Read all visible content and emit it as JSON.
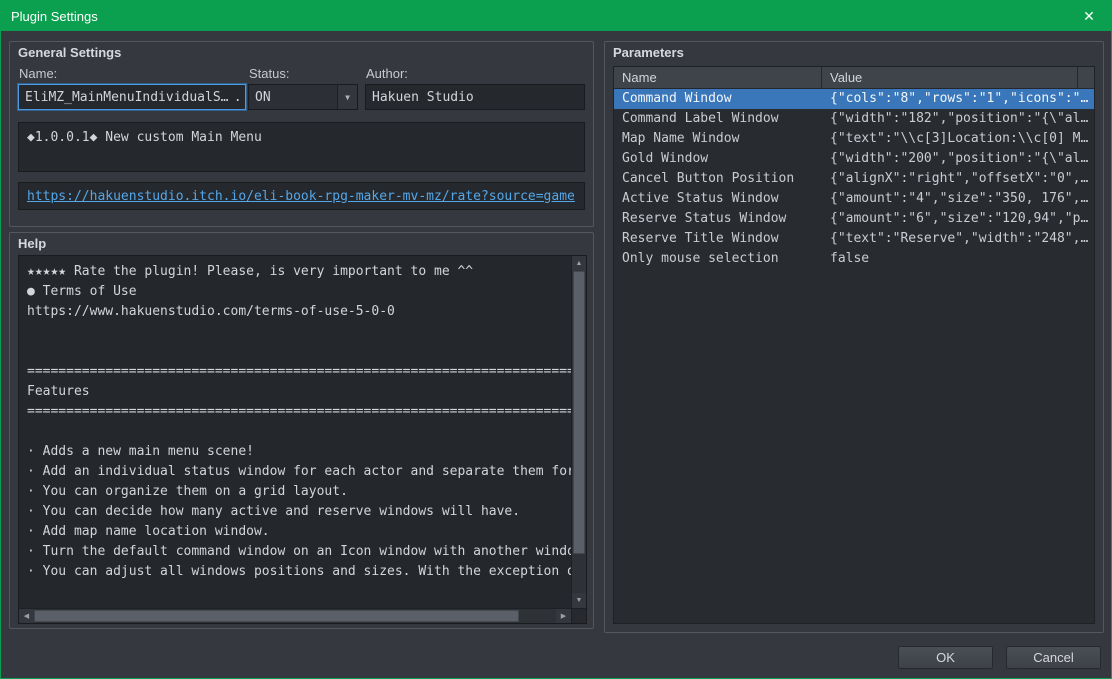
{
  "window": {
    "title": "Plugin Settings"
  },
  "icons": {
    "close": "✕",
    "dropdown": "▼",
    "up": "▲",
    "down": "▼",
    "left": "◀",
    "right": "▶"
  },
  "colors": {
    "titlebar_green": "#0ba04f",
    "selection_blue": "#3a76ba",
    "link_blue": "#54a7e8"
  },
  "general": {
    "title": "General Settings",
    "name_label": "Name:",
    "name_value": "EliMZ_MainMenuIndividualS… …",
    "status_label": "Status:",
    "status_value": "ON",
    "author_label": "Author:",
    "author_value": "Hakuen Studio",
    "description": "◆1.0.0.1◆ New custom Main Menu",
    "link": "https://hakuenstudio.itch.io/eli-book-rpg-maker-mv-mz/rate?source=game"
  },
  "help": {
    "title": "Help",
    "text": "★★★★★ Rate the plugin! Please, is very important to me ^^\n● Terms of Use\nhttps://www.hakuenstudio.com/terms-of-use-5-0-0\n\n\n==========================================================================================\nFeatures\n==========================================================================================\n\n· Adds a new main menu scene!\n· Add an individual status window for each actor and separate them for Active\n· You can organize them on a grid layout.\n· You can decide how many active and reserve windows will have.\n· Add map name location window.\n· Turn the default command window on an Icon window with another window to wo\n· You can adjust all windows positions and sizes. With the exception of Map,\n\n==========================================================================================\nHow to use"
  },
  "parameters": {
    "title": "Parameters",
    "columns": [
      "Name",
      "Value"
    ],
    "rows": [
      {
        "name": "Command Window",
        "value": "{\"cols\":\"8\",\"rows\":\"1\",\"icons\":\"…"
      },
      {
        "name": "Command Label Window",
        "value": "{\"width\":\"182\",\"position\":\"{\\\"al…"
      },
      {
        "name": "Map Name Window",
        "value": "{\"text\":\"\\\\c[3]Location:\\\\c[0] M…"
      },
      {
        "name": "Gold Window",
        "value": "{\"width\":\"200\",\"position\":\"{\\\"al…"
      },
      {
        "name": "Cancel Button Position",
        "value": "{\"alignX\":\"right\",\"offsetX\":\"0\",…"
      },
      {
        "name": "Active Status Window",
        "value": "{\"amount\":\"4\",\"size\":\"350, 176\",…"
      },
      {
        "name": "Reserve Status Window",
        "value": "{\"amount\":\"6\",\"size\":\"120,94\",\"p…"
      },
      {
        "name": "Reserve Title Window",
        "value": "{\"text\":\"Reserve\",\"width\":\"248\",…"
      },
      {
        "name": "Only mouse selection",
        "value": "false"
      }
    ]
  },
  "footer": {
    "ok": "OK",
    "cancel": "Cancel"
  }
}
